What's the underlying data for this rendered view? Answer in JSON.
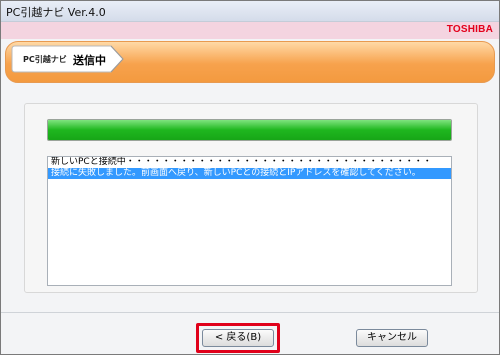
{
  "window": {
    "title": "PC引越ナビ Ver.4.0",
    "brand": "TOSHIBA"
  },
  "breadcrumb": {
    "app": "PC引越ナビ",
    "step": "送信中"
  },
  "progress": {
    "fraction": 1.0,
    "color": "#1fb71f"
  },
  "log": {
    "lines": [
      {
        "text": "新しいPCと接続中・・・・・・・・・・・・・・・・・・・・・・・・・・・・・・・・・・",
        "selected": false
      },
      {
        "text": "接続に失敗しました。前画面へ戻り、新しいPCとの接続とIPアドレスを確認してください。",
        "selected": true
      }
    ]
  },
  "buttons": {
    "back": "< 戻る(B)",
    "cancel": "キャンセル"
  },
  "colors": {
    "highlight": "#e0001a",
    "brand": "#e3001b",
    "header": "#f39a3f"
  }
}
